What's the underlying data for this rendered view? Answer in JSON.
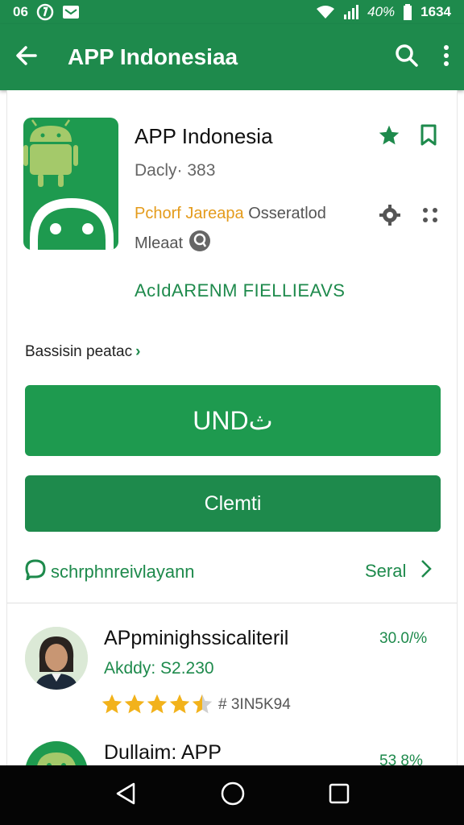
{
  "status_bar": {
    "time_left": "06",
    "signal_text": "40%",
    "clock": "1634"
  },
  "app_bar": {
    "title": "APP Indonesiaa"
  },
  "app_header": {
    "name": "APP Indonesia",
    "developer": "Dacly· 383",
    "meta_orange": "Pchorf Jareapa",
    "meta_grey": "Osseratlod",
    "meta2": "Mleaat",
    "green_label": "AcIdARENM FIELLIEAVS"
  },
  "section": {
    "label": "Bassisin peatac",
    "chevron": "›"
  },
  "buttons": {
    "primary_label": "UNDث",
    "secondary_label": "Clemti"
  },
  "reviews": {
    "link_label": "schrphnreivlayann",
    "see_all_label": "Seral"
  },
  "review_item": {
    "title": "APpminighssicaliteril",
    "subtitle": "Akddy: S2.230",
    "percent": "30.0/%",
    "rating": 4.5,
    "count": "# 3IN5K94"
  },
  "app_item": {
    "title": "Dullaim: APP",
    "percent": "53 8%"
  },
  "colors": {
    "primary": "#1e8a4c",
    "accent": "#1e9a4f",
    "orange": "#e49b1b",
    "star": "#f2b21b"
  },
  "icons": {
    "back": "arrow-left-icon",
    "search": "search-icon",
    "menu": "more-vert-icon",
    "star": "star-icon",
    "bookmark": "bookmark-icon",
    "gear": "gear-icon",
    "dots": "grid-dots-icon",
    "chat": "chat-icon",
    "chevron": "chevron-right-icon"
  }
}
